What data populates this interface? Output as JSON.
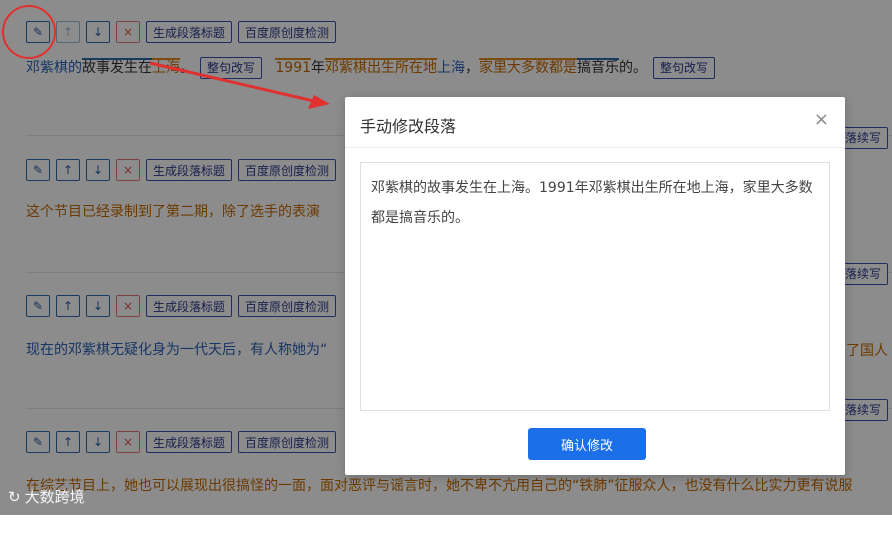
{
  "toolbar": {
    "gen_title": "生成段落标题",
    "originality": "百度原创度检测"
  },
  "paragraphs": [
    {
      "segs": [
        {
          "t": "邓紫棋的",
          "c": "b"
        },
        {
          "t": "故事发生在",
          "c": "u"
        },
        {
          "t": "上海",
          "c": "o"
        },
        {
          "t": "。",
          "c": ""
        }
      ],
      "rewrite": "整句改写",
      "segs2": [
        {
          "t": "1991",
          "c": "o"
        },
        {
          "t": "年",
          "c": ""
        },
        {
          "t": "邓紫棋",
          "c": "o"
        },
        {
          "t": "出生所在地",
          "c": "o"
        },
        {
          "t": "上海",
          "c": "b"
        },
        {
          "t": "，",
          "c": ""
        },
        {
          "t": "家里",
          "c": "o"
        },
        {
          "t": "大多数",
          "c": "o"
        },
        {
          "t": "都是",
          "c": "o"
        },
        {
          "t": "搞音乐",
          "c": "u"
        },
        {
          "t": "的。",
          "c": ""
        }
      ],
      "rewrite2": "整句改写"
    },
    {
      "text": "这个节目已经录制到了第二期，除了选手的表演"
    },
    {
      "text": "现在的邓紫棋无疑化身为一代天后，有人称她为“"
    },
    {
      "text": "在综艺节目上，她也可以展现出很搞怪的一面，面对恶评与谣言时，她不卑不亢用自己的“铁肺”征服众人，也没有什么比实力更有说服"
    }
  ],
  "right_tail": {
    "continue": "落续写",
    "people": "了国人"
  },
  "modal": {
    "title": "手动修改段落",
    "close": "×",
    "content": "邓紫棋的故事发生在上海。1991年邓紫棋出生所在地上海，家里大多数都是搞音乐的。",
    "confirm": "确认修改"
  },
  "watermark": "大数跨境"
}
